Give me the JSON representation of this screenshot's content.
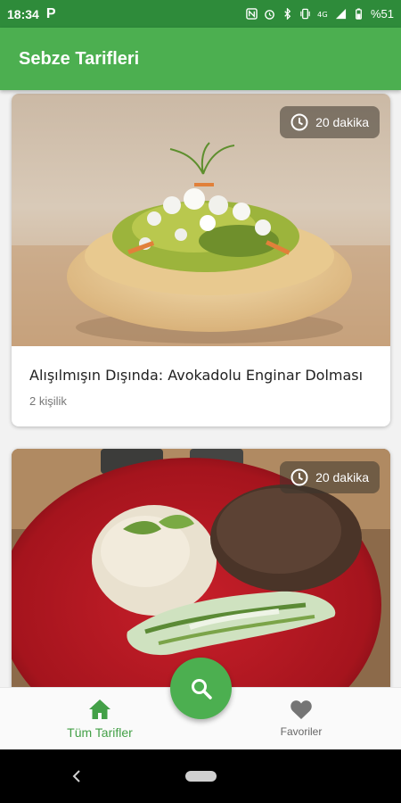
{
  "status_bar": {
    "time": "18:34",
    "app_indicator": "P",
    "battery": "%51",
    "icons": [
      "nfc-icon",
      "alarm-icon",
      "bluetooth-icon",
      "vibrate-icon",
      "lte-icon",
      "signal-icon",
      "battery-icon"
    ]
  },
  "app_bar": {
    "title": "Sebze Tarifleri"
  },
  "recipes": [
    {
      "time": "20 dakika",
      "title": "Alışılmışın Dışında: Avokadolu Enginar Dolması",
      "servings": "2 kişilik"
    },
    {
      "time": "20 dakika",
      "title": "",
      "servings": ""
    }
  ],
  "bottom_nav": {
    "items": [
      {
        "label": "Tüm Tarifler",
        "icon": "home-icon",
        "active": true
      },
      {
        "label": "Favoriler",
        "icon": "heart-icon",
        "active": false
      }
    ],
    "fab_icon": "search-icon"
  },
  "colors": {
    "status_bar": "#2e8b3a",
    "app_bar": "#4caf50",
    "accent": "#43a047"
  }
}
